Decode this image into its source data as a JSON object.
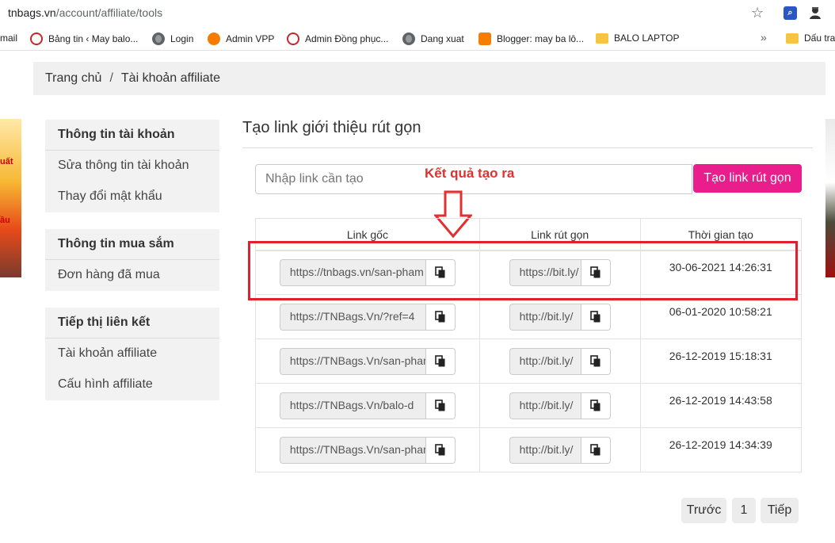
{
  "browser": {
    "url_domain": "tnbags.vn",
    "url_path": "/account/affiliate/tools",
    "bookmarks": [
      {
        "label": "mail",
        "icon": "none"
      },
      {
        "label": "Bảng tin ‹ May balo...",
        "icon": "tnv-logo-icon"
      },
      {
        "label": "Login",
        "icon": "globe-icon"
      },
      {
        "label": "Admin VPP",
        "icon": "orange-logo-icon"
      },
      {
        "label": "Admin Đồng phục...",
        "icon": "tnv-logo-icon"
      },
      {
        "label": "Dang xuat",
        "icon": "globe-icon"
      },
      {
        "label": "Blogger: may ba lô...",
        "icon": "blogger-icon"
      },
      {
        "label": "BALO LAPTOP",
        "icon": "folder-icon"
      },
      {
        "label": "Dấu tra",
        "icon": "folder-icon"
      }
    ],
    "more": "»"
  },
  "breadcrumb": {
    "home": "Trang chủ",
    "separator": "/",
    "current": "Tài khoản affiliate"
  },
  "banners": {
    "left_text_1": "uất",
    "left_text_2": "ầu"
  },
  "sidebar": {
    "groups": [
      {
        "title": "Thông tin tài khoản",
        "items": [
          "Sửa thông tin tài khoản",
          "Thay đổi mật khẩu"
        ]
      },
      {
        "title": "Thông tin mua sắm",
        "items": [
          "Đơn hàng đã mua"
        ]
      },
      {
        "title": "Tiếp thị liên kết",
        "items": [
          "Tài khoản affiliate",
          "Cấu hình affiliate"
        ]
      }
    ]
  },
  "main": {
    "title": "Tạo link giới thiệu rút gọn",
    "input_placeholder": "Nhập link cần tạo",
    "create_button": "Tạo link rút gọn",
    "annotation": "Kết quả tạo ra",
    "annotation_color": "#e03030",
    "accent_color": "#e91e8c"
  },
  "table": {
    "headers": [
      "Link gốc",
      "Link rút gọn",
      "Thời gian tạo"
    ],
    "rows": [
      {
        "original": "https://tnbags.vn/san-pham",
        "short": "https://bit.ly/",
        "time": "30-06-2021 14:26:31"
      },
      {
        "original": "https://TNBags.Vn/?ref=4",
        "short": "http://bit.ly/",
        "time": "06-01-2020 10:58:21"
      },
      {
        "original": "https://TNBags.Vn/san-pham",
        "short": "http://bit.ly/",
        "time": "26-12-2019 15:18:31"
      },
      {
        "original": "https://TNBags.Vn/balo-d",
        "short": "http://bit.ly/",
        "time": "26-12-2019 14:43:58"
      },
      {
        "original": "https://TNBags.Vn/san-pham",
        "short": "http://bit.ly/",
        "time": "26-12-2019 14:34:39"
      }
    ]
  },
  "pagination": {
    "prev": "Trước",
    "page": "1",
    "next": "Tiếp"
  }
}
